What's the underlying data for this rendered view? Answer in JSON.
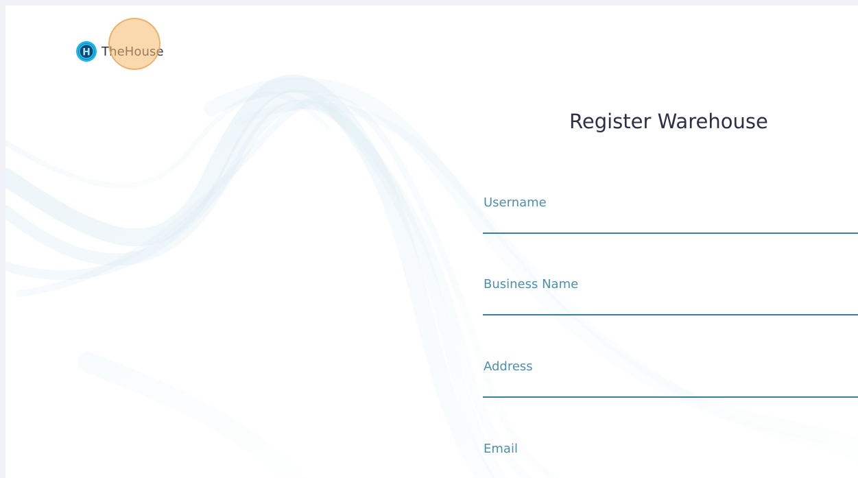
{
  "brand": {
    "name": "TheHouse",
    "logo_letter": "H",
    "icon": "house-logo-icon",
    "accent_color": "#1fb6e6"
  },
  "form": {
    "title": "Register Warehouse",
    "fields": [
      {
        "label": "Username",
        "value": "",
        "placeholder": ""
      },
      {
        "label": "Business Name",
        "value": "",
        "placeholder": ""
      },
      {
        "label": "Address",
        "value": "",
        "placeholder": ""
      },
      {
        "label": "Email",
        "value": "",
        "placeholder": ""
      }
    ]
  },
  "colors": {
    "label": "#4d8eae",
    "underline": "#3b7f9f",
    "title": "#2d2f47",
    "background": "#ffffff",
    "frame": "#f1f2f7"
  }
}
